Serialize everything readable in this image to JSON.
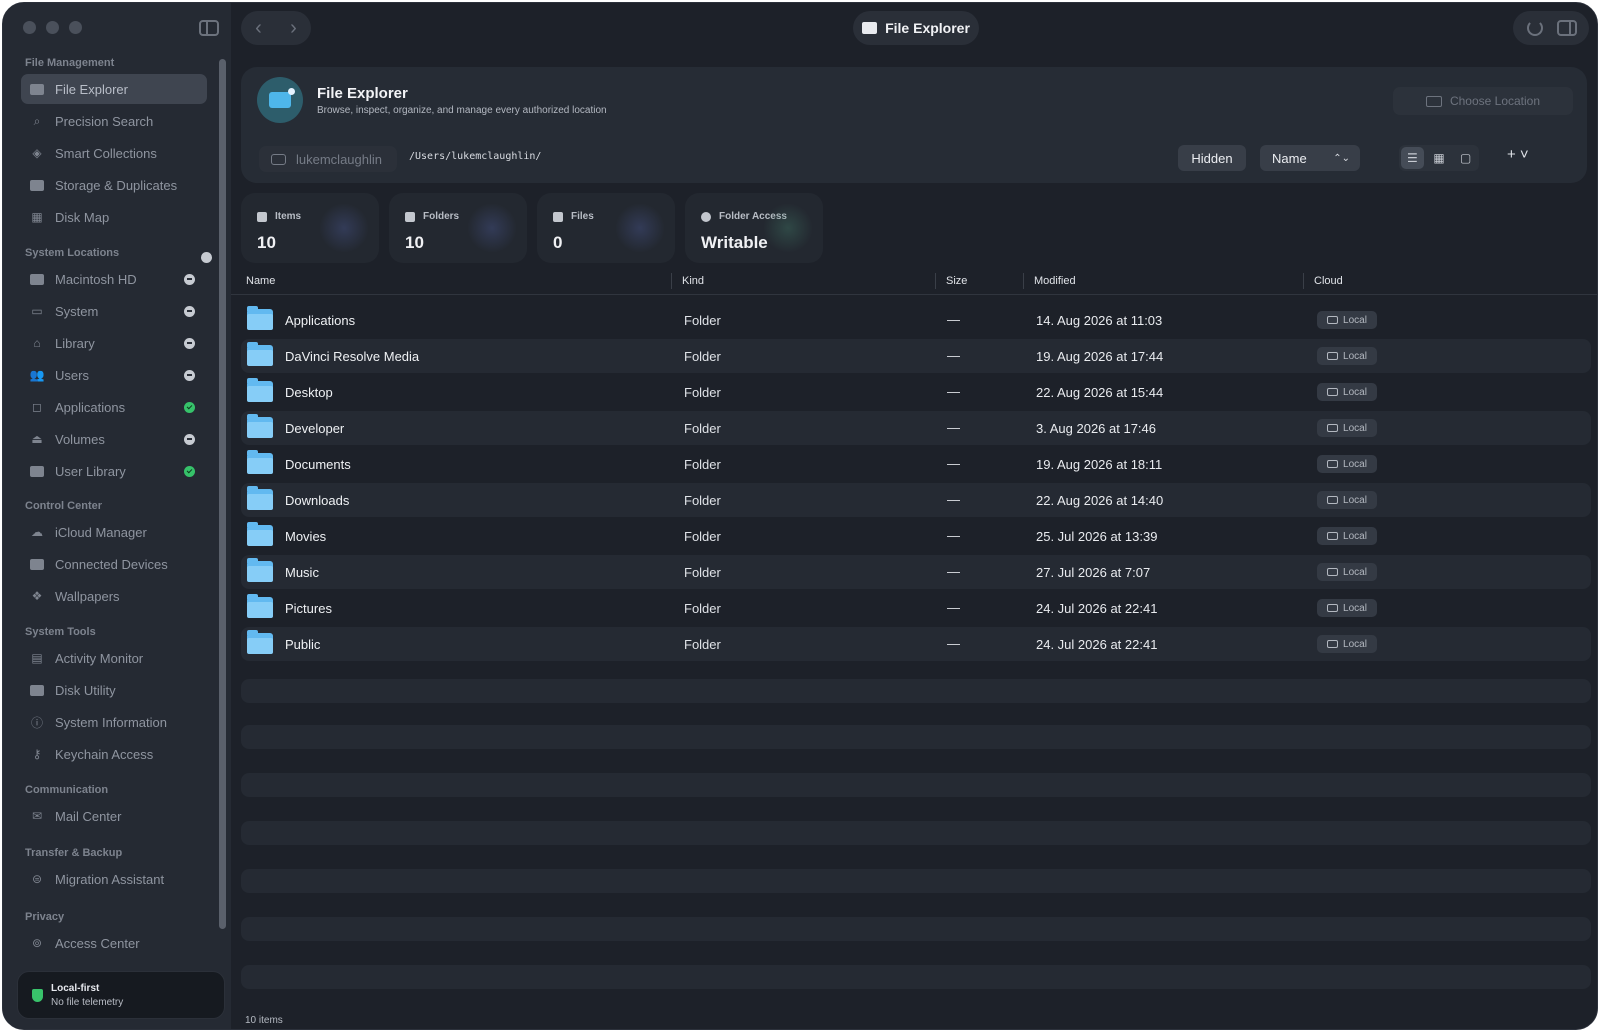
{
  "window": {
    "title": "File Explorer"
  },
  "sidebar": {
    "sections": {
      "file_management": "File Management",
      "system_locations": "System Locations",
      "control_center": "Control Center",
      "system_tools": "System Tools",
      "communication": "Communication",
      "transfer_backup": "Transfer & Backup",
      "privacy": "Privacy"
    },
    "file_management": [
      "File Explorer",
      "Precision Search",
      "Smart Collections",
      "Storage & Duplicates",
      "Disk Map"
    ],
    "system_locations": [
      "Macintosh HD",
      "System",
      "Library",
      "Users",
      "Applications",
      "Volumes",
      "User Library"
    ],
    "control_center": [
      "iCloud Manager",
      "Connected Devices",
      "Wallpapers"
    ],
    "system_tools": [
      "Activity Monitor",
      "Disk Utility",
      "System Information",
      "Keychain Access"
    ],
    "communication": [
      "Mail Center"
    ],
    "transfer_backup": [
      "Migration Assistant"
    ],
    "privacy": [
      "Access Center"
    ],
    "privacy_card": {
      "title": "Local-first",
      "subtitle": "No file telemetry"
    }
  },
  "header": {
    "title": "File Explorer",
    "subtitle": "Browse, inspect, organize, and manage every authorized location",
    "choose_location": "Choose Location",
    "user": "lukemclaughlin",
    "path": "/Users/lukemclaughlin/",
    "hidden_label": "Hidden",
    "sort_value": "Name",
    "add_label": "+ ˅"
  },
  "stats": [
    {
      "label": "Items",
      "value": "10"
    },
    {
      "label": "Folders",
      "value": "10"
    },
    {
      "label": "Files",
      "value": "0"
    },
    {
      "label": "Folder Access",
      "value": "Writable"
    }
  ],
  "table": {
    "columns": [
      "Name",
      "Kind",
      "Size",
      "Modified",
      "Cloud"
    ],
    "rows": [
      {
        "name": "Applications",
        "kind": "Folder",
        "size": "—",
        "modified": "14. Aug 2026 at 11:03",
        "cloud": "Local"
      },
      {
        "name": "DaVinci Resolve Media",
        "kind": "Folder",
        "size": "—",
        "modified": "19. Aug 2026 at 17:44",
        "cloud": "Local"
      },
      {
        "name": "Desktop",
        "kind": "Folder",
        "size": "—",
        "modified": "22. Aug 2026 at 15:44",
        "cloud": "Local"
      },
      {
        "name": "Developer",
        "kind": "Folder",
        "size": "—",
        "modified": "3. Aug 2026 at 17:46",
        "cloud": "Local"
      },
      {
        "name": "Documents",
        "kind": "Folder",
        "size": "—",
        "modified": "19. Aug 2026 at 18:11",
        "cloud": "Local"
      },
      {
        "name": "Downloads",
        "kind": "Folder",
        "size": "—",
        "modified": "22. Aug 2026 at 14:40",
        "cloud": "Local"
      },
      {
        "name": "Movies",
        "kind": "Folder",
        "size": "—",
        "modified": "25. Jul 2026 at 13:39",
        "cloud": "Local"
      },
      {
        "name": "Music",
        "kind": "Folder",
        "size": "—",
        "modified": "27. Jul 2026 at 7:07",
        "cloud": "Local"
      },
      {
        "name": "Pictures",
        "kind": "Folder",
        "size": "—",
        "modified": "24. Jul 2026 at 22:41",
        "cloud": "Local"
      },
      {
        "name": "Public",
        "kind": "Folder",
        "size": "—",
        "modified": "24. Jul 2026 at 22:41",
        "cloud": "Local"
      }
    ]
  },
  "footer": {
    "count": "10 items"
  },
  "colors": {
    "accent": "#62b9f0",
    "success": "#36c26a",
    "background": "#1d2129"
  }
}
